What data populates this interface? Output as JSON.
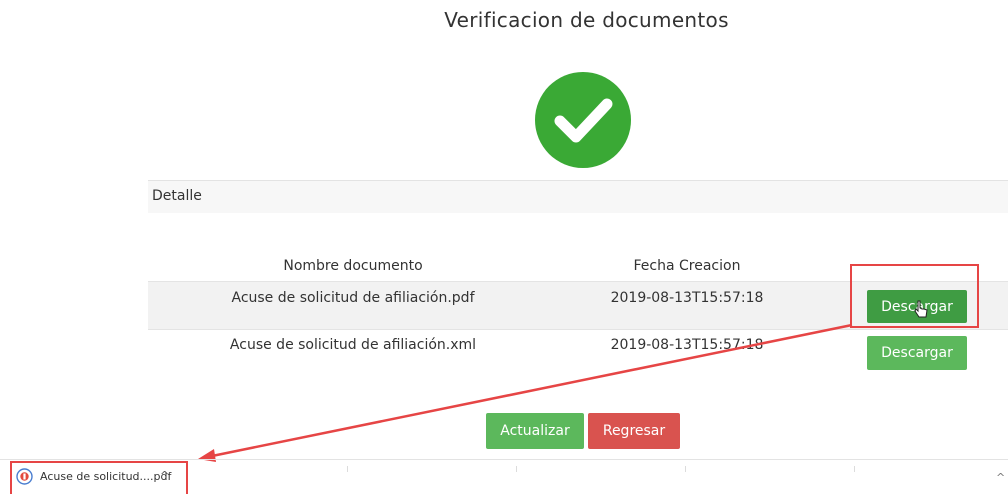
{
  "page": {
    "title": "Verificacion de documentos"
  },
  "panel": {
    "heading": "Detalle"
  },
  "table": {
    "columns": [
      "Nombre documento",
      "Fecha Creacion"
    ],
    "rows": [
      {
        "name": "Acuse de solicitud de afiliación.pdf",
        "date": "2019-08-13T15:57:18",
        "action": "Descargar"
      },
      {
        "name": "Acuse de solicitud de afiliación.xml",
        "date": "2019-08-13T15:57:18",
        "action": "Descargar"
      }
    ]
  },
  "actions": {
    "update": "Actualizar",
    "back": "Regresar"
  },
  "download_bar": {
    "file_label": "Acuse de solicitud....pdf",
    "chevron": "^",
    "right_chevron": "^"
  },
  "colors": {
    "success": "#3aa935",
    "primary_button": "#5cb85c",
    "danger_button": "#d9534f",
    "annotation": "#e64545"
  },
  "icons": [
    "check-icon",
    "cursor-hand-icon",
    "pdf-file-icon",
    "chevron-up-icon",
    "annotation-arrow"
  ]
}
